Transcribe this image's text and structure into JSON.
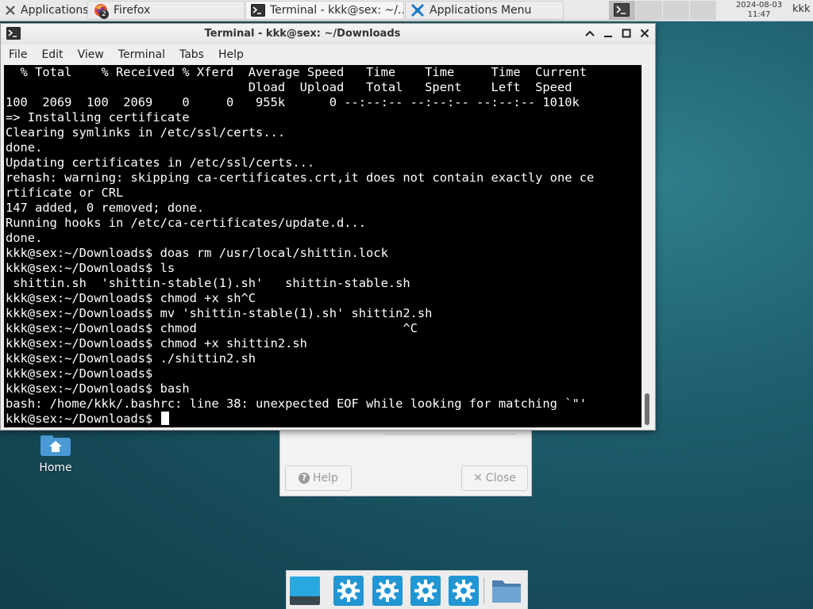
{
  "colors": {
    "desktop": "#1d5a69",
    "terminal_bg": "#000000",
    "terminal_fg": "#ffffff",
    "settings_blue": "#2196d3"
  },
  "top_panel": {
    "applications_button": {
      "label": "Applications",
      "icon": "xfce-mouse-icon"
    },
    "tasks": [
      {
        "label": "Firefox",
        "icon": "firefox-icon",
        "badge": "2"
      },
      {
        "label": "Terminal - kkk@sex: ~/...",
        "icon": "terminal-icon"
      },
      {
        "label": "Applications Menu",
        "icon": "xfce-mouse-icon"
      }
    ],
    "clock": {
      "date": "2024-08-03",
      "time": "11:47"
    },
    "user": "kkk"
  },
  "terminal": {
    "title": "Terminal - kkk@sex: ~/Downloads",
    "menu": [
      "File",
      "Edit",
      "View",
      "Terminal",
      "Tabs",
      "Help"
    ],
    "lines": [
      "  % Total    % Received % Xferd  Average Speed   Time    Time     Time  Current",
      "                                 Dload  Upload   Total   Spent    Left  Speed",
      "100  2069  100  2069    0     0   955k      0 --:--:-- --:--:-- --:--:-- 1010k",
      "=> Installing certificate",
      "Clearing symlinks in /etc/ssl/certs...",
      "done.",
      "Updating certificates in /etc/ssl/certs...",
      "rehash: warning: skipping ca-certificates.crt,it does not contain exactly one ce",
      "rtificate or CRL",
      "147 added, 0 removed; done.",
      "Running hooks in /etc/ca-certificates/update.d...",
      "done.",
      "kkk@sex:~/Downloads$ doas rm /usr/local/shittin.lock",
      "kkk@sex:~/Downloads$ ls",
      " shittin.sh  'shittin-stable(1).sh'   shittin-stable.sh",
      "kkk@sex:~/Downloads$ chmod +x sh^C",
      "kkk@sex:~/Downloads$ mv 'shittin-stable(1).sh' shittin2.sh",
      "kkk@sex:~/Downloads$ chmod                            ^C",
      "kkk@sex:~/Downloads$ chmod +x shittin2.sh",
      "kkk@sex:~/Downloads$ ./shittin2.sh",
      "kkk@sex:~/Downloads$",
      "kkk@sex:~/Downloads$ bash",
      "bash: /home/kkk/.bashrc: line 38: unexpected EOF while looking for matching `\"'"
    ],
    "prompt": "kkk@sex:~/Downloads$ "
  },
  "dialog": {
    "help_label": "Help",
    "close_label": "Close"
  },
  "desktop_icons": [
    {
      "label": "Home",
      "icon": "home-folder-icon"
    }
  ],
  "dock": {
    "items": [
      {
        "name": "show-desktop",
        "icon": "show-desktop-icon"
      },
      {
        "name": "settings-1",
        "icon": "gear-icon"
      },
      {
        "name": "settings-2",
        "icon": "gear-icon"
      },
      {
        "name": "settings-3",
        "icon": "gear-icon"
      },
      {
        "name": "settings-4",
        "icon": "gear-icon"
      },
      {
        "name": "file-manager",
        "icon": "folder-icon"
      }
    ]
  }
}
